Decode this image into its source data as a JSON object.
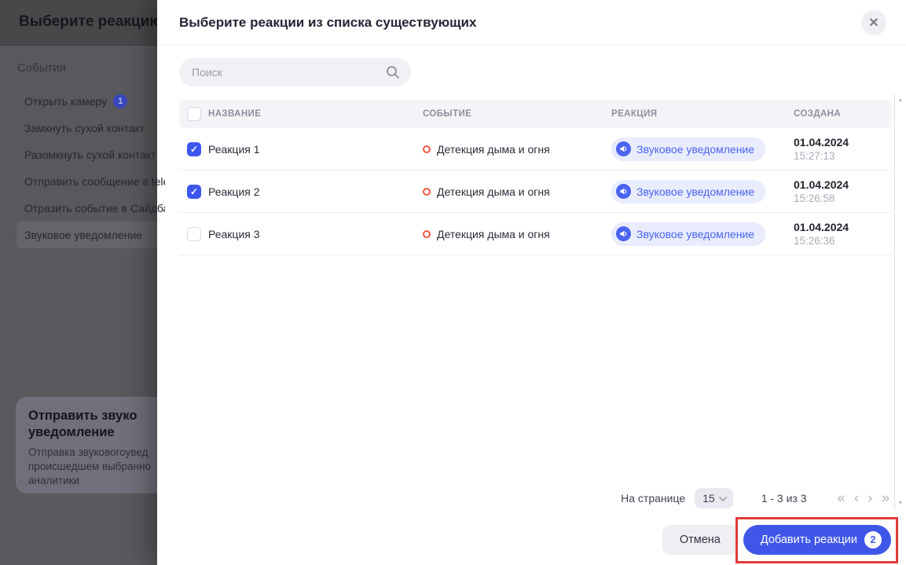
{
  "colors": {
    "accent_blue": "#3f56e8",
    "checkbox_blue": "#3d56ee",
    "pill_bg": "#e9ecfd",
    "pill_text": "#4a63f0",
    "event_dot": "#f15642",
    "annotation_red": "#e23b3b",
    "overlay_panel": "#59595d"
  },
  "underlay": {
    "title": "Выберите реакцию",
    "section_label": "События",
    "events": [
      {
        "label": "Открыть камеру",
        "badge": "1"
      },
      {
        "label": "Замкнуть сухой контакт"
      },
      {
        "label": "Разомкнуть сухой контакт"
      },
      {
        "label": "Отправить сообщение в tele"
      },
      {
        "label": "Отразить событие в Сайдба"
      },
      {
        "label": "Звуковое уведомление"
      }
    ],
    "card": {
      "title_line1": "Отправить звуко",
      "title_line2": "уведомление",
      "desc_line1": "Отправка звуковогоувед",
      "desc_line2": "происшедшем выбранно",
      "desc_line3": "аналитики"
    }
  },
  "modal": {
    "title": "Выберите реакции из списка существующих",
    "close_glyph": "✕",
    "search": {
      "placeholder": "Поиск"
    },
    "table": {
      "headers": {
        "name": "НАЗВАНИЕ",
        "event": "СОБЫТИЕ",
        "reaction": "РЕАКЦИЯ",
        "created": "СОЗДАНА"
      },
      "rows": [
        {
          "checked": true,
          "name": "Реакция 1",
          "event": "Детекция дыма и огня",
          "reaction": "Звуковое уведомление",
          "date": "01.04.2024",
          "time": "15:27:13"
        },
        {
          "checked": true,
          "name": "Реакция 2",
          "event": "Детекция дыма и огня",
          "reaction": "Звуковое уведомление",
          "date": "01.04.2024",
          "time": "15:26:58"
        },
        {
          "checked": false,
          "name": "Реакция 3",
          "event": "Детекция дыма и огня",
          "reaction": "Звуковое уведомление",
          "date": "01.04.2024",
          "time": "15:26:36"
        }
      ],
      "check_glyph": "✓"
    },
    "pagination": {
      "per_page_label": "На странице",
      "per_page_value": "15",
      "range_label": "1 - 3 из 3",
      "first_glyph": "«",
      "prev_glyph": "‹",
      "next_glyph": "›",
      "last_glyph": "»"
    },
    "footer": {
      "cancel_label": "Отмена",
      "add_label": "Добавить реакции",
      "add_badge": "2"
    }
  }
}
